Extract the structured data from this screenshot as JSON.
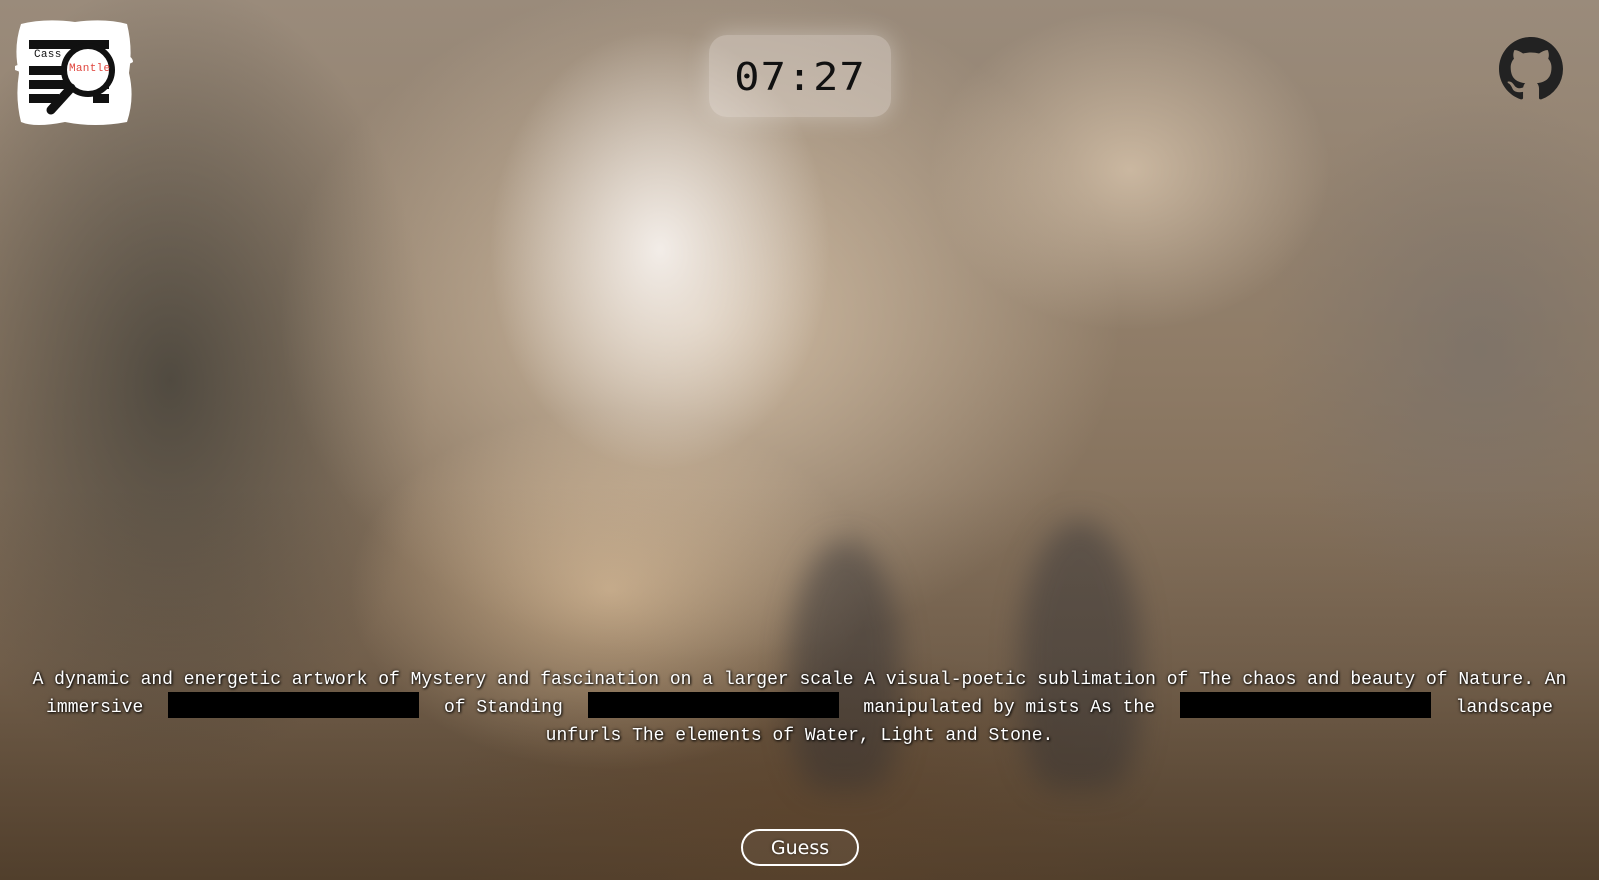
{
  "logo": {
    "line1": "Cass",
    "line2": "Mantle"
  },
  "timer": {
    "text": "07:27"
  },
  "passage": {
    "seg1": "A dynamic and energetic artwork of Mystery and fascination on a larger scale A visual-poetic sublimation of The chaos and beauty of Nature. An immersive",
    "seg2": "of Standing",
    "seg3": "manipulated by mists As the",
    "seg4": "landscape unfurls The elements of Water, Light and Stone."
  },
  "guess_button": {
    "label": "Guess"
  },
  "icons": {
    "github": "github-icon",
    "search": "magnifier-icon"
  },
  "colors": {
    "accent": "#e0443c",
    "redaction": "#000000",
    "text": "#ffffff"
  }
}
